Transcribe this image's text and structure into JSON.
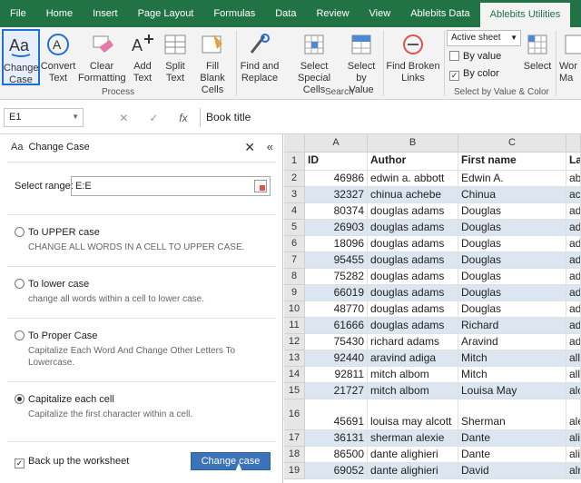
{
  "tabs": [
    "File",
    "Home",
    "Insert",
    "Page Layout",
    "Formulas",
    "Data",
    "Review",
    "View",
    "Ablebits Data",
    "Ablebits Utilities"
  ],
  "active_tab": "Ablebits Utilities",
  "ribbon": {
    "buttons": [
      {
        "label1": "Change",
        "label2": "Case",
        "icon": "change-case-icon"
      },
      {
        "label1": "Convert",
        "label2": "Text",
        "icon": "convert-text-icon"
      },
      {
        "label1": "Clear",
        "label2": "Formatting",
        "icon": "eraser-icon"
      },
      {
        "label1": "Add",
        "label2": "Text",
        "icon": "add-text-icon"
      },
      {
        "label1": "Split",
        "label2": "Text",
        "icon": "split-text-icon"
      },
      {
        "label1": "Fill Blank",
        "label2": "Cells",
        "icon": "fill-blank-icon"
      },
      {
        "label1": "Find and",
        "label2": "Replace",
        "icon": "find-replace-icon"
      },
      {
        "label1": "Select",
        "label2": "Special Cells",
        "icon": "select-special-icon"
      },
      {
        "label1": "Select",
        "label2": "by Value",
        "icon": "select-value-icon"
      },
      {
        "label1": "Find Broken",
        "label2": "Links",
        "icon": "broken-link-icon"
      },
      {
        "label1": "Select",
        "label2": "",
        "icon": "select-grid-icon"
      },
      {
        "label1": "Wor",
        "label2": "Ma",
        "icon": "worksheet-icon"
      }
    ],
    "groups": {
      "process": "Process",
      "search": "Search",
      "select_by": "Select by Value & Color"
    },
    "dropdown_value": "Active sheet",
    "by_value": "By value",
    "by_color": "By color"
  },
  "formula_bar": {
    "name_box": "E1",
    "fx": "fx",
    "value": "Book title"
  },
  "pane": {
    "title": "Change Case",
    "aa": "Aa",
    "range_label": "Select range:",
    "range_value": "E:E",
    "options": [
      {
        "label": "To UPPER case",
        "desc": "CHANGE ALL WORDS IN A CELL TO UPPER CASE."
      },
      {
        "label": "To lower case",
        "desc": "change all words within a cell to lower case."
      },
      {
        "label": "To Proper Case",
        "desc": "Capitalize Each Word And Change Other Letters To Lowercase."
      },
      {
        "label": "Capitalize each cell",
        "desc": "Capitalize the first character within a cell."
      }
    ],
    "backup_label": "Back up the worksheet",
    "button_label": "Change case"
  },
  "grid": {
    "columns": [
      "A",
      "B",
      "C",
      ""
    ],
    "row_numbers": [
      "1",
      "2",
      "3",
      "4",
      "5",
      "6",
      "7",
      "8",
      "9",
      "10",
      "11",
      "12",
      "13",
      "14",
      "15",
      "16",
      "17",
      "18",
      "19"
    ],
    "header_row": [
      "ID",
      "Author",
      "First name",
      "La"
    ],
    "rows": [
      [
        "46986",
        "edwin a. abbott",
        "Edwin A.",
        "ab"
      ],
      [
        "32327",
        "chinua achebe",
        "Chinua",
        "ac"
      ],
      [
        "80374",
        "douglas adams",
        "Douglas",
        "ad"
      ],
      [
        "26903",
        "douglas adams",
        "Douglas",
        "ad"
      ],
      [
        "18096",
        "douglas adams",
        "Douglas",
        "ad"
      ],
      [
        "95455",
        "douglas adams",
        "Douglas",
        "ad"
      ],
      [
        "75282",
        "douglas adams",
        "Douglas",
        "ad"
      ],
      [
        "66019",
        "douglas adams",
        "Douglas",
        "ad"
      ],
      [
        "48770",
        "douglas adams",
        "Douglas",
        "ad"
      ],
      [
        "61666",
        "douglas adams",
        "Richard",
        "ad"
      ],
      [
        "75430",
        "richard adams",
        "Aravind",
        "ad"
      ],
      [
        "92440",
        "aravind adiga",
        "Mitch",
        "all"
      ],
      [
        "92811",
        "mitch albom",
        "Mitch",
        "all"
      ],
      [
        "21727",
        "mitch albom",
        "Louisa May",
        "alc"
      ],
      [
        "45691",
        "louisa may alcott",
        "Sherman",
        "ale"
      ],
      [
        "36131",
        "sherman alexie",
        "Dante",
        "ali"
      ],
      [
        "86500",
        "dante alighieri",
        "Dante",
        "ali"
      ],
      [
        "69052",
        "dante alighieri",
        "David",
        "alr"
      ]
    ]
  }
}
